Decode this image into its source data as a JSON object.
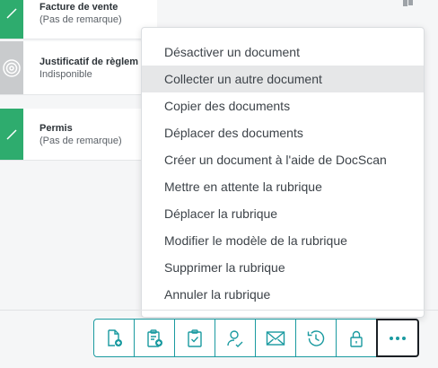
{
  "documents": [
    {
      "title": "Facture de vente",
      "subtitle": "(Pas de remarque)",
      "status": "check-icon",
      "status_color": "#2eac6e"
    },
    {
      "title": "Justificatif de règlem",
      "subtitle": "Indisponible",
      "status": "target-icon",
      "status_color": "#c9cbcd"
    },
    {
      "title": "Permis",
      "subtitle": "(Pas de remarque)",
      "status": "check-icon",
      "status_color": "#2eac6e"
    }
  ],
  "menu": {
    "items": [
      {
        "label": "Désactiver un document"
      },
      {
        "label": "Collecter un autre document",
        "hovered": true
      },
      {
        "label": "Copier des documents"
      },
      {
        "label": "Déplacer des documents"
      },
      {
        "label": "Créer un document à l'aide de DocScan"
      },
      {
        "label": "Mettre en attente la rubrique"
      },
      {
        "label": "Déplacer la rubrique"
      },
      {
        "label": "Modifier le modèle de la rubrique"
      },
      {
        "label": "Supprimer la rubrique"
      },
      {
        "label": "Annuler la rubrique"
      }
    ]
  },
  "toolbar": {
    "buttons": [
      {
        "icon": "add-document-icon"
      },
      {
        "icon": "add-clipboard-icon"
      },
      {
        "icon": "clipboard-check-icon"
      },
      {
        "icon": "user-sign-icon"
      },
      {
        "icon": "envelope-icon"
      },
      {
        "icon": "history-icon"
      },
      {
        "icon": "lock-icon"
      },
      {
        "icon": "more-icon",
        "active": true
      }
    ]
  },
  "colors": {
    "accent": "#1a9aa0",
    "success": "#2eac6e",
    "unavailable": "#c9cbcd",
    "hover": "#e6e7e8"
  }
}
